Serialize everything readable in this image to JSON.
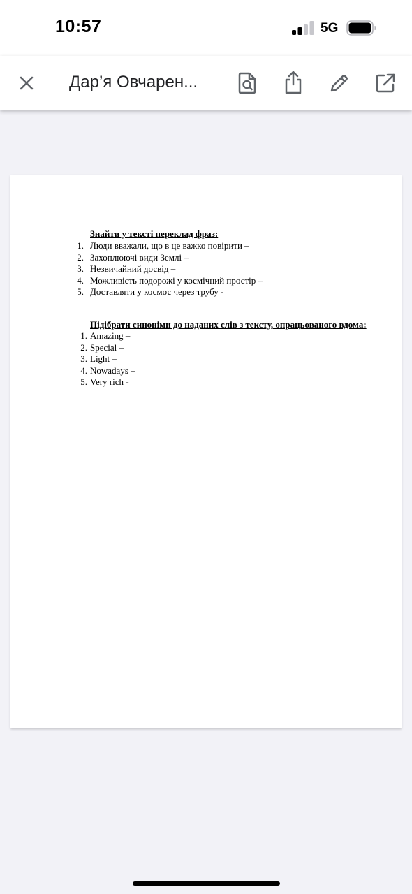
{
  "status_bar": {
    "time": "10:57",
    "network": "5G",
    "signal_bars_active": 2,
    "signal_bars_total": 4
  },
  "toolbar": {
    "title": "Дар’я Овчарен...",
    "icons": [
      "close-icon",
      "find-in-document-icon",
      "share-icon",
      "edit-pencil-icon",
      "open-external-icon"
    ]
  },
  "document": {
    "section1": {
      "heading": "Знайти у тексті переклад фраз: ",
      "items": [
        {
          "num": "1.",
          "text": "Люди вважали, що в це важко повірити –"
        },
        {
          "num": "2.",
          "text": "Захоплюючі види Землі –"
        },
        {
          "num": "3.",
          "text": "Незвичайний досвід –"
        },
        {
          "num": "4.",
          "text": "Можливість подорожі у космічний простір –"
        },
        {
          "num": "5.",
          "text": "Доставляти у космос через трубу -"
        }
      ]
    },
    "section2": {
      "heading": "Підібрати синоніми до наданих слів з тексту, опрацьованого вдома:",
      "items": [
        {
          "num": "1.",
          "text": "Amazing –"
        },
        {
          "num": "2.",
          "text": "Special –"
        },
        {
          "num": "3.",
          "text": "Light –"
        },
        {
          "num": "4.",
          "text": "Nowadays –"
        },
        {
          "num": "5.",
          "text": "Very rich -"
        }
      ]
    }
  },
  "colors": {
    "background": "#f2f2f7",
    "toolbar": "#ffffff",
    "icon": "#5f6368",
    "page": "#ffffff"
  }
}
